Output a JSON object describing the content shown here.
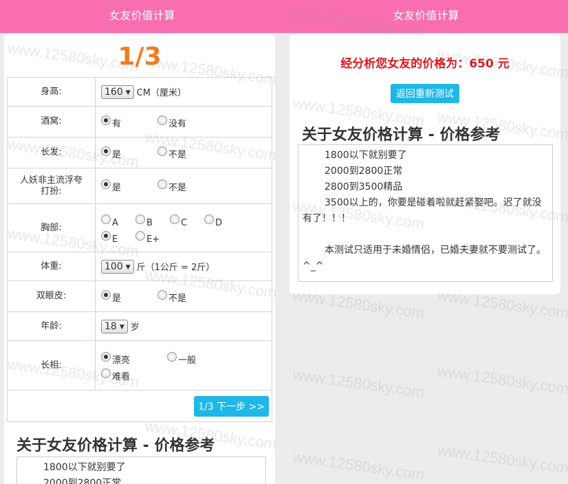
{
  "app_title": "女友价值计算",
  "step": "1/3",
  "form": {
    "height": {
      "label": "身高:",
      "value": "160",
      "unit": "CM（厘米）"
    },
    "dimples": {
      "label": "酒窝:",
      "options": [
        "有",
        "没有"
      ],
      "selected": "有"
    },
    "long_hair": {
      "label": "长发:",
      "options": [
        "是",
        "不是"
      ],
      "selected": "是"
    },
    "style": {
      "label_line1": "人妖非主流浮夸",
      "label_line2": "打扮:",
      "options": [
        "是",
        "不是"
      ],
      "selected": "是"
    },
    "chest": {
      "label": "胸部:",
      "options": [
        "A",
        "B",
        "C",
        "D",
        "E",
        "E+"
      ],
      "selected": "E"
    },
    "weight": {
      "label": "体重:",
      "value": "100",
      "unit": "斤（1公斤 = 2斤）"
    },
    "double_eyelid": {
      "label": "双眼皮:",
      "options": [
        "是",
        "不是"
      ],
      "selected": "是"
    },
    "age": {
      "label": "年龄:",
      "value": "18",
      "unit": "岁"
    },
    "looks": {
      "label": "长相:",
      "options": [
        "漂亮",
        "一般",
        "难看"
      ],
      "selected": "漂亮"
    },
    "next_button": "1/3 下一步 >>"
  },
  "reference": {
    "title": "关于女友价格计算 - 价格参考",
    "lines": [
      "1800以下就别要了",
      "2000到2800正常",
      "2800到3500精品",
      "3500以上的，你要是碰着啦就赶紧娶吧。迟了就没有了！！！",
      "本测试只适用于未婚情侣，已婚夫妻就不要测试了。 ^_^"
    ]
  },
  "result": {
    "text": "经分析您女友的价格为：650 元",
    "retest_button": "返回重新测试"
  },
  "watermark": "www.12580sky.com"
}
